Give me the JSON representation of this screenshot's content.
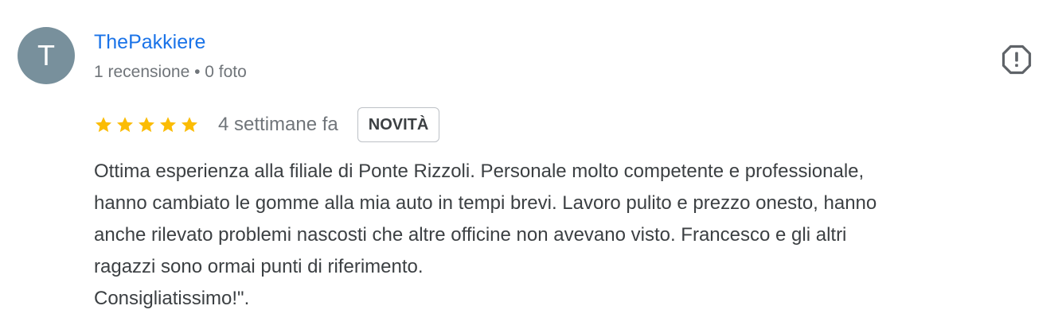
{
  "author": {
    "initial": "T",
    "name": "ThePakkiere",
    "meta": "1 recensione • 0 foto",
    "avatar_color": "#78909c"
  },
  "actions": {
    "flag_icon": "report-flag-icon"
  },
  "rating": {
    "stars": 5,
    "max_stars": 5,
    "star_color": "#fbbc04",
    "time_ago": "4 settimane fa",
    "badge": "NOVITÀ"
  },
  "review": {
    "lines": [
      "Ottima esperienza alla filiale di Ponte Rizzoli. Personale molto competente e professionale,",
      "hanno cambiato le gomme alla mia auto in tempi brevi. Lavoro pulito e prezzo onesto, hanno",
      "anche rilevato problemi nascosti che altre officine non avevano visto. Francesco e gli altri",
      "ragazzi sono ormai punti di riferimento.",
      "Consigliatissimo!\"."
    ]
  },
  "colors": {
    "name_link": "#1a73e8",
    "secondary_text": "#70757a",
    "body_text": "#3c4043"
  }
}
